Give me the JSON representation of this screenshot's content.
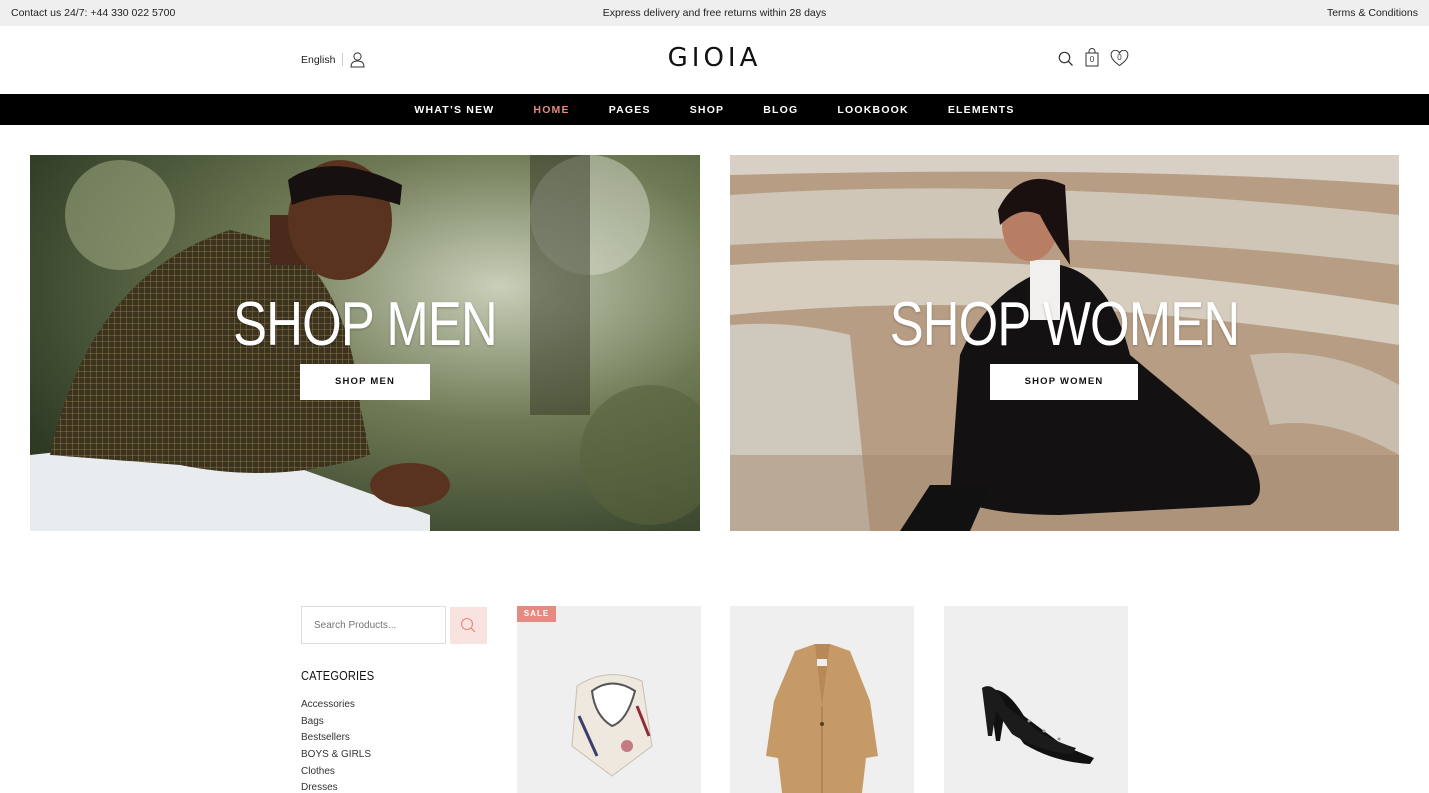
{
  "topbar": {
    "contact": "Contact us 24/7: +44 330 022 5700",
    "promo": "Express delivery and free returns within 28 days",
    "terms": "Terms & Conditions"
  },
  "header": {
    "language": "English",
    "logo": "GIOIA",
    "cart_count": "0",
    "wishlist_count": "0"
  },
  "nav": {
    "items": [
      {
        "label": "WHAT’S NEW"
      },
      {
        "label": "HOME"
      },
      {
        "label": "PAGES"
      },
      {
        "label": "SHOP"
      },
      {
        "label": "BLOG"
      },
      {
        "label": "LOOKBOOK"
      },
      {
        "label": "ELEMENTS"
      }
    ],
    "active_color": "#e48a80"
  },
  "banners": {
    "men": {
      "title": "SHOP MEN",
      "button": "SHOP MEN"
    },
    "women": {
      "title": "SHOP WOMEN",
      "button": "SHOP WOMEN"
    }
  },
  "sidebar": {
    "search_placeholder": "Search Products...",
    "categories_title": "CATEGORIES",
    "categories": [
      "Accessories",
      "Bags",
      "Bestsellers",
      "BOYS & GIRLS",
      "Clothes",
      "Dresses"
    ]
  },
  "products": {
    "sale_badge": "SALE"
  },
  "colors": {
    "accent": "#e48a80",
    "nav_bg": "#000000",
    "topbar_bg": "#efefef"
  }
}
